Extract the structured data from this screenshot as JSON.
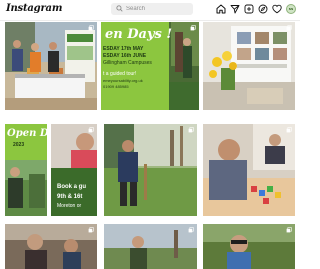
{
  "header": {
    "logo": "Instagram",
    "search_placeholder": "Search",
    "avatar_initials": "ss",
    "icons": [
      "home-icon",
      "direct-message-icon",
      "new-post-icon",
      "explore-icon",
      "activity-heart-icon"
    ]
  },
  "posts": [
    {
      "id": "p1",
      "description_icon": "multi-photo-icon"
    },
    {
      "id": "p2",
      "title": "en Days !",
      "line1": "ESDAY 17th MAY",
      "line2": "ESDAY 16th JUNE",
      "line3": "Gillingham Campuses",
      "line4": "t a guided tour!",
      "line5": "emeyoursability.org.uk",
      "line6": "01909 485985",
      "description_icon": "multi-photo-icon"
    },
    {
      "id": "p3",
      "description_icon": "multi-photo-icon"
    },
    {
      "id": "p4",
      "title": "Open Days",
      "year": "2023",
      "description_icon": "multi-photo-icon"
    },
    {
      "id": "p5",
      "line1": "Book a gu",
      "line2": "9th & 16t",
      "line3": "Moreton or",
      "description_icon": "multi-photo-icon"
    },
    {
      "id": "p6",
      "description_icon": "multi-photo-icon"
    },
    {
      "id": "p7",
      "description_icon": "multi-photo-icon"
    },
    {
      "id": "p8",
      "description_icon": "multi-photo-icon"
    },
    {
      "id": "p9",
      "description_icon": "multi-photo-icon"
    },
    {
      "id": "p10",
      "description_icon": "multi-photo-icon"
    }
  ],
  "colors": {
    "accent_green": "#8cc63f",
    "poster_cream": "#f4f1e3",
    "dark_green": "#3b6b2a"
  }
}
